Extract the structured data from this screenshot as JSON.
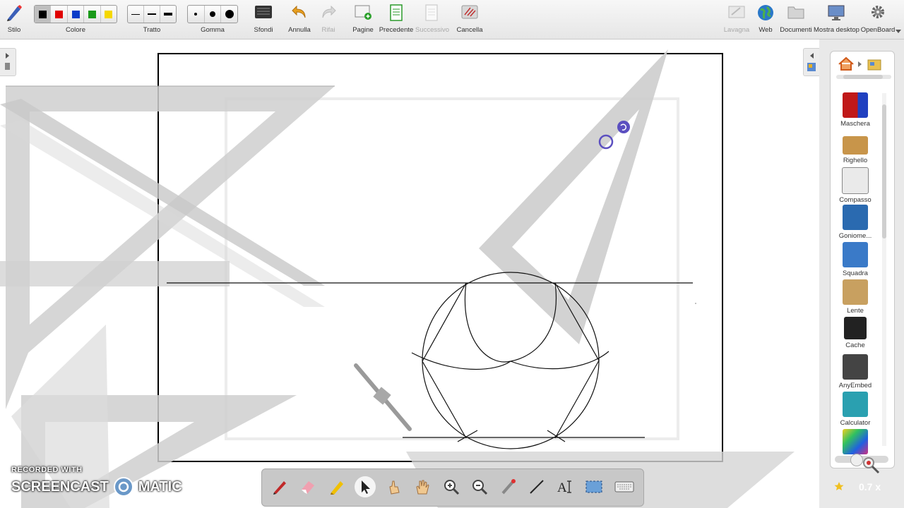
{
  "toolbar": {
    "stile": "Stilo",
    "colore": "Colore",
    "tratto": "Tratto",
    "gomma": "Gomma",
    "sfondi": "Sfondi",
    "annulla": "Annulla",
    "rifai": "Rifai",
    "pagine": "Pagine",
    "precedente": "Precedente",
    "successivo": "Successivo",
    "cancella": "Cancella",
    "lavagna": "Lavagna",
    "web": "Web",
    "documenti": "Documenti",
    "mostra_desktop": "Mostra desktop",
    "openboard": "OpenBoard",
    "colors": [
      "#000000",
      "#e00000",
      "#0a3cc8",
      "#1a9a1a",
      "#f5d800"
    ]
  },
  "library": {
    "items": [
      {
        "label": "Maschera"
      },
      {
        "label": "Righello"
      },
      {
        "label": "Compasso"
      },
      {
        "label": "Goniome..."
      },
      {
        "label": "Squadra"
      },
      {
        "label": "Lente"
      },
      {
        "label": "Cache"
      },
      {
        "label": "AnyEmbed"
      },
      {
        "label": "Calculator"
      }
    ]
  },
  "dock": {
    "tools": [
      "pen-icon",
      "eraser-icon",
      "highlighter-icon",
      "pointer-icon",
      "interact-icon",
      "hand-icon",
      "zoom-in-icon",
      "zoom-out-icon",
      "laser-icon",
      "line-icon",
      "text-icon",
      "capture-icon",
      "keyboard-icon"
    ]
  },
  "zoom": "0.7 x",
  "watermark": {
    "recorded": "RECORDED WITH",
    "brand_left": "SCREENCAST",
    "brand_right": "MATIC"
  }
}
